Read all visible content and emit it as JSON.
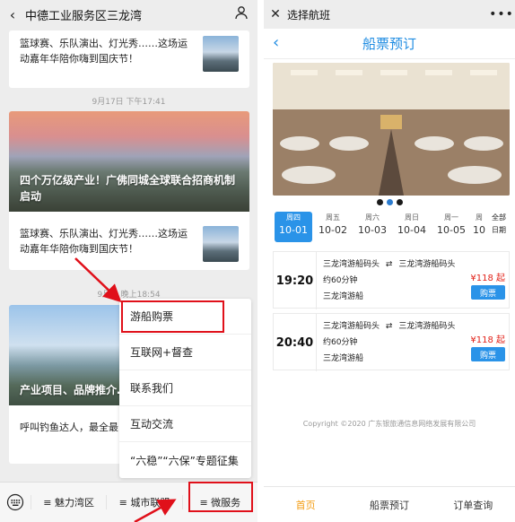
{
  "left": {
    "header": {
      "title": "中德工业服务区三龙湾"
    },
    "card_top": {
      "text": "篮球赛、乐队演出、灯光秀……这场运动嘉年华陪你嗨到国庆节！"
    },
    "timestamp1": "9月17日 下午17:41",
    "card2": {
      "headline": "四个万亿级产业！广佛同城全球联合招商机制启动",
      "text": "篮球赛、乐队演出、灯光秀……这场运动嘉年华陪你嗨到国庆节！"
    },
    "timestamp2": "9月... 晚上18:54",
    "card3": {
      "headline": "产业项目、品牌推介……进！",
      "text": "呼叫钓鱼达人，最全最... 山潭洲"
    },
    "menu": {
      "items": [
        {
          "label": "游船购票"
        },
        {
          "label": "互联网+督查"
        },
        {
          "label": "联系我们"
        },
        {
          "label": "互动交流"
        },
        {
          "label": "“六稳”“六保”专题征集"
        }
      ]
    },
    "bottom_tabs": [
      {
        "label": "≡ 魅力湾区"
      },
      {
        "label": "≡ 城市联盟"
      },
      {
        "label": "≡ 微服务"
      }
    ]
  },
  "right": {
    "header": {
      "title": "选择航班"
    },
    "nav_title": "船票预订",
    "dates": [
      {
        "weekday": "周四",
        "date": "10-01"
      },
      {
        "weekday": "周五",
        "date": "10-02"
      },
      {
        "weekday": "周六",
        "date": "10-03"
      },
      {
        "weekday": "周日",
        "date": "10-04"
      },
      {
        "weekday": "周一",
        "date": "10-05"
      },
      {
        "weekday": "周",
        "date": "10"
      }
    ],
    "all_dates": {
      "line1": "全部",
      "line2": "日期"
    },
    "voyages": [
      {
        "time": "19:20",
        "from": "三龙湾游船码头",
        "arrow": "⇄",
        "to": "三龙湾游船码头",
        "duration": "约60分钟",
        "ship": "三龙湾游船",
        "price": "¥118 起",
        "buy": "购票"
      },
      {
        "time": "20:40",
        "from": "三龙湾游船码头",
        "arrow": "⇄",
        "to": "三龙湾游船码头",
        "duration": "约60分钟",
        "ship": "三龙湾游船",
        "price": "¥118 起",
        "buy": "购票"
      }
    ],
    "copyright": "Copyright ©2020 广东银旅通信息网络发展有限公司",
    "tabs": [
      {
        "label": "首页"
      },
      {
        "label": "船票预订"
      },
      {
        "label": "订单查询"
      }
    ],
    "colors": {
      "accent": "#2a93e8",
      "active_tab": "#f39c12",
      "price": "#e2231a",
      "highlight": "#e0101a"
    }
  }
}
